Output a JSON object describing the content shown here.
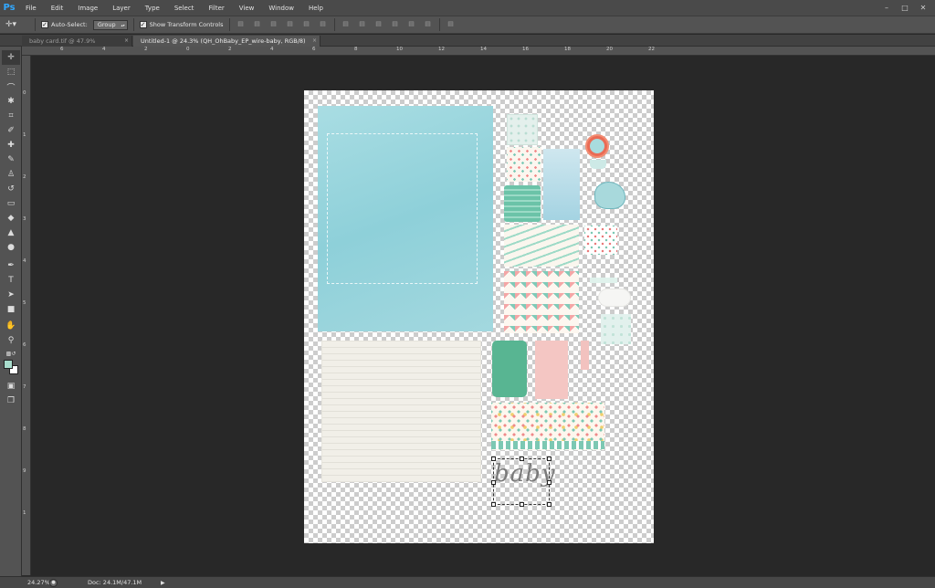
{
  "app": {
    "logo": "Ps"
  },
  "menu": [
    "File",
    "Edit",
    "Image",
    "Layer",
    "Type",
    "Select",
    "Filter",
    "View",
    "Window",
    "Help"
  ],
  "window_controls": {
    "minimize": "–",
    "maximize": "□",
    "close": "✕"
  },
  "options_bar": {
    "tool_icon": "move-tool-icon",
    "auto_select_label": "Auto-Select:",
    "auto_select_checked": true,
    "auto_select_target": "Group",
    "show_transform_label": "Show Transform Controls",
    "show_transform_checked": true
  },
  "tabs": [
    {
      "label": "baby card.tif @ 47.9% (RGB/8) *",
      "active": false,
      "close": "×"
    },
    {
      "label": "Untitled-1 @ 24.3% (QH_OhBaby_EP_wire-baby, RGB/8) *",
      "active": true,
      "close": "×"
    }
  ],
  "ruler": {
    "top": [
      "6",
      "4",
      "2",
      "0",
      "2",
      "4",
      "6",
      "8",
      "10",
      "12",
      "14",
      "16",
      "18",
      "20",
      "22"
    ],
    "left": [
      "0",
      "1",
      "2",
      "3",
      "4",
      "5",
      "6",
      "7",
      "8",
      "9",
      "1"
    ]
  },
  "tools": [
    {
      "name": "move-tool-icon",
      "glyph": "✛",
      "active": true
    },
    {
      "name": "marquee-tool-icon",
      "glyph": "⬚"
    },
    {
      "name": "lasso-tool-icon",
      "glyph": "⌒"
    },
    {
      "name": "quick-select-tool-icon",
      "glyph": "✱"
    },
    {
      "name": "crop-tool-icon",
      "glyph": "⌗"
    },
    {
      "name": "eyedropper-tool-icon",
      "glyph": "✐"
    },
    {
      "name": "healing-brush-tool-icon",
      "glyph": "✚"
    },
    {
      "name": "brush-tool-icon",
      "glyph": "✎"
    },
    {
      "name": "clone-stamp-tool-icon",
      "glyph": "♙"
    },
    {
      "name": "history-brush-tool-icon",
      "glyph": "↺"
    },
    {
      "name": "eraser-tool-icon",
      "glyph": "▭"
    },
    {
      "name": "paint-bucket-tool-icon",
      "glyph": "◆"
    },
    {
      "name": "blur-tool-icon",
      "glyph": "▲"
    },
    {
      "name": "dodge-tool-icon",
      "glyph": "●"
    },
    {
      "name": "pen-tool-icon",
      "glyph": "✒"
    },
    {
      "name": "type-tool-icon",
      "glyph": "T"
    },
    {
      "name": "path-select-tool-icon",
      "glyph": "➤"
    },
    {
      "name": "shape-tool-icon",
      "glyph": "■"
    },
    {
      "name": "hand-tool-icon",
      "glyph": "✋"
    },
    {
      "name": "zoom-tool-icon",
      "glyph": "⚲"
    }
  ],
  "colors": {
    "foreground": "#a8dccc",
    "background": "#ffffff",
    "workspace": "#282828",
    "panel": "#535353"
  },
  "canvas": {
    "text_layer": "baby"
  },
  "status": {
    "zoom": "24.27%",
    "doc": "Doc: 24.1M/47.1M",
    "arrow": "▶"
  }
}
